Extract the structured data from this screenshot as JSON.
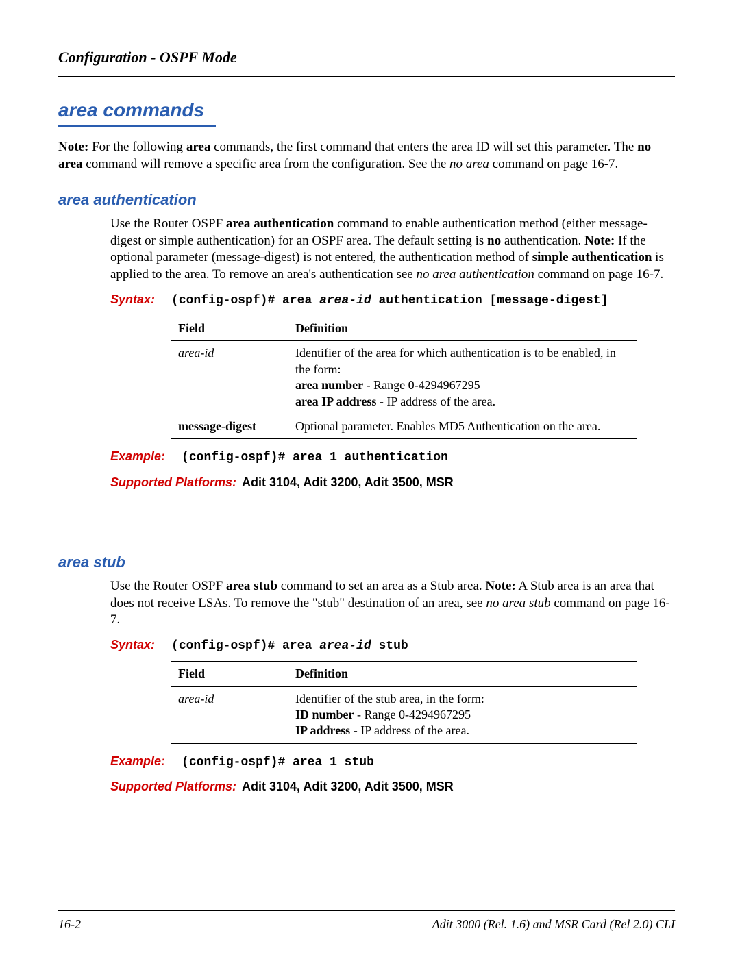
{
  "header": {
    "running_head": "Configuration - OSPF Mode"
  },
  "section": {
    "title": "area commands",
    "intro": {
      "note_label": "Note:",
      "text1": " For the following ",
      "bold1": "area",
      "text2": " commands, the first command that enters the area ID will set this parameter. The ",
      "bold2": "no area",
      "text3": " command will remove a specific area from the configuration. See the ",
      "italic1": "no area",
      "text4": " command on page 16-7."
    }
  },
  "auth": {
    "title": "area authentication",
    "p1a": "Use the Router OSPF ",
    "p1b_bold": "area authentication",
    "p1c": " command to enable authentication method (either message-digest or simple authentication) for an OSPF area. The default setting is ",
    "p1d_bold": "no",
    "p1e": " authentication. ",
    "note_label": "Note:",
    "p2a": " If the optional parameter (message-digest) is not entered, the authentication method of ",
    "p2b_bold": "simple authentication",
    "p2c": " is applied to the area. To remove an area's authentication see ",
    "p2d_italic": "no area authentication",
    "p2e": " command on page 16-7.",
    "syntax_label": "Syntax:",
    "syntax": {
      "pre": "(config-ospf)# area ",
      "areaid": "area-id",
      "post": " authentication [message-digest]"
    },
    "table": {
      "h1": "Field",
      "h2": "Definition",
      "r1_field": "area-id",
      "r1_def_line1": "Identifier of the area for which authentication is to be enabled, in the form:",
      "r1_def_b1": "area number",
      "r1_def_t1": " - Range 0-4294967295",
      "r1_def_b2": "area IP address",
      "r1_def_t2": " - IP address of the area.",
      "r2_field": "message-digest",
      "r2_def": "Optional parameter. Enables MD5 Authentication on the area."
    },
    "example_label": "Example:",
    "example_cmd": "(config-ospf)# area 1 authentication",
    "platforms_label": "Supported Platforms:",
    "platforms_value": " Adit 3104, Adit 3200, Adit 3500, MSR"
  },
  "stub": {
    "title": "area stub",
    "p1a": "Use the Router OSPF ",
    "p1b_bold": "area stub",
    "p1c": " command to set an area as a Stub area. ",
    "note_label": "Note:",
    "p1d": " A Stub area is an area that does not receive LSAs. To remove the \"stub\" destination of an area, see ",
    "p1e_italic": "no area stub",
    "p1f": " command on page 16-7.",
    "syntax_label": "Syntax:",
    "syntax": {
      "pre": "(config-ospf)# area ",
      "areaid": "area-id",
      "post": " stub"
    },
    "table": {
      "h1": "Field",
      "h2": "Definition",
      "r1_field": "area-id",
      "r1_def_line1": "Identifier of the stub area, in the form:",
      "r1_def_b1": "ID number",
      "r1_def_t1": " - Range 0-4294967295",
      "r1_def_b2": "IP address",
      "r1_def_t2": " - IP address of the area."
    },
    "example_label": "Example:",
    "example_cmd": "(config-ospf)# area 1 stub",
    "platforms_label": "Supported Platforms:",
    "platforms_value": " Adit 3104, Adit 3200, Adit 3500, MSR"
  },
  "footer": {
    "page": "16-2",
    "doc": "Adit 3000 (Rel. 1.6) and MSR Card (Rel 2.0) CLI"
  }
}
